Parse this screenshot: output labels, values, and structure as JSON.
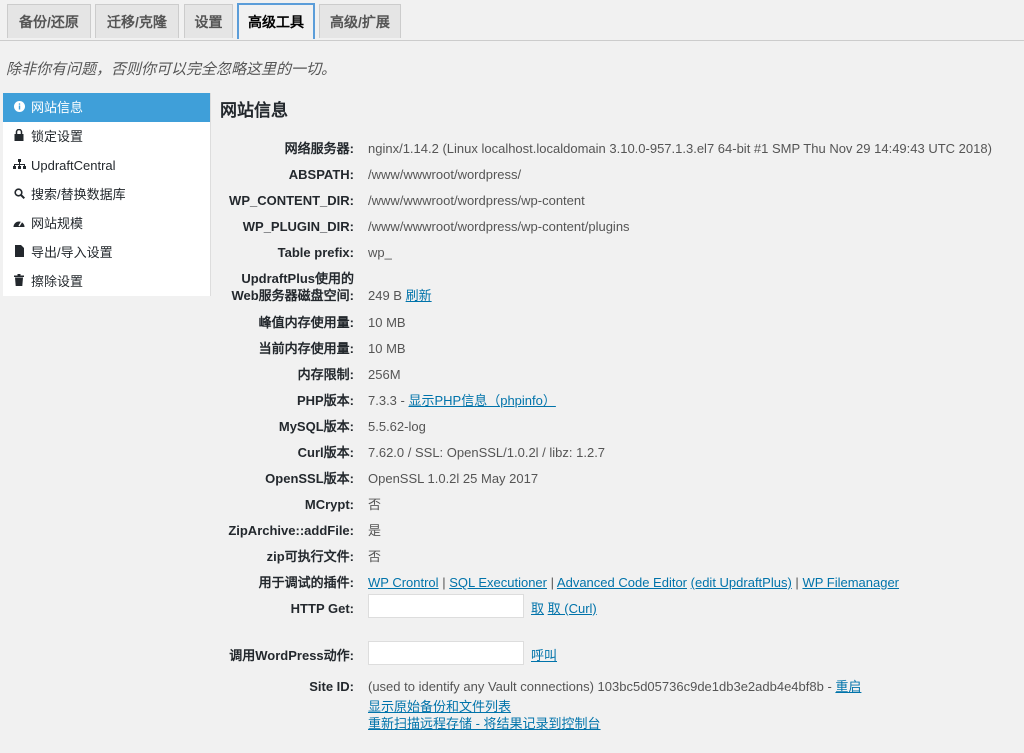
{
  "tabs": [
    {
      "label": "备份/还原"
    },
    {
      "label": "迁移/克隆"
    },
    {
      "label": "设置"
    },
    {
      "label": "高级工具"
    },
    {
      "label": "高级/扩展"
    }
  ],
  "notice": "除非你有问题，否则你可以完全忽略这里的一切。",
  "sidebar": {
    "items": [
      {
        "label": "网站信息",
        "icon": "info-icon"
      },
      {
        "label": "锁定设置",
        "icon": "lock-icon"
      },
      {
        "label": "UpdraftCentral",
        "icon": "sitemap-icon"
      },
      {
        "label": "搜索/替换数据库",
        "icon": "search-icon"
      },
      {
        "label": "网站规模",
        "icon": "dashboard-icon"
      },
      {
        "label": "导出/导入设置",
        "icon": "document-icon"
      },
      {
        "label": "擦除设置",
        "icon": "trash-icon"
      }
    ]
  },
  "main": {
    "title": "网站信息",
    "rows": {
      "web_server": {
        "label": "网络服务器:",
        "value": "nginx/1.14.2 (Linux localhost.localdomain 3.10.0-957.1.3.el7 64-bit #1 SMP Thu Nov 29 14:49:43 UTC 2018)"
      },
      "abspath": {
        "label": "ABSPATH:",
        "value": "/www/wwwroot/wordpress/"
      },
      "wp_content": {
        "label": "WP_CONTENT_DIR:",
        "value": "/www/wwwroot/wordpress/wp-content"
      },
      "wp_plugin": {
        "label": "WP_PLUGIN_DIR:",
        "value": "/www/wwwroot/wordpress/wp-content/plugins"
      },
      "table_prefix": {
        "label": "Table prefix:",
        "value": "wp_"
      },
      "disk": {
        "label_line1": "UpdraftPlus使用的",
        "label_line2": "Web服务器磁盘空间:",
        "value": "249 B",
        "link": "刷新"
      },
      "peak_mem": {
        "label": "峰值内存使用量:",
        "value": "10 MB"
      },
      "cur_mem": {
        "label": "当前内存使用量:",
        "value": "10 MB"
      },
      "mem_limit": {
        "label": "内存限制:",
        "value": "256M"
      },
      "php": {
        "label": "PHP版本:",
        "value": "7.3.3 -",
        "link": "显示PHP信息（phpinfo）"
      },
      "mysql": {
        "label": "MySQL版本:",
        "value": "5.5.62-log"
      },
      "curl": {
        "label": "Curl版本:",
        "value": "7.62.0 / SSL: OpenSSL/1.0.2l / libz: 1.2.7"
      },
      "openssl": {
        "label": "OpenSSL版本:",
        "value": "OpenSSL 1.0.2l 25 May 2017"
      },
      "mcrypt": {
        "label": "MCrypt:",
        "value": "否"
      },
      "ziparchive": {
        "label": "ZipArchive::addFile:",
        "value": "是"
      },
      "zip_exec": {
        "label": "zip可执行文件:",
        "value": "否"
      },
      "debug_plugins": {
        "label": "用于调试的插件:",
        "links": [
          "WP Crontrol",
          "SQL Executioner",
          "Advanced Code Editor",
          "(edit UpdraftPlus)",
          "WP Filemanager"
        ],
        "sep": "|"
      },
      "http_get": {
        "label": "HTTP Get:",
        "input_value": "",
        "btn1": "取",
        "btn2": "取 (Curl)"
      },
      "wp_action": {
        "label": "调用WordPress动作:",
        "input_value": "",
        "btn": "呼叫"
      },
      "site_id": {
        "label": "Site ID:",
        "value": "(used to identify any Vault connections) 103bc5d05736c9de1db3e2adb4e4bf8b -",
        "link": "重启"
      }
    },
    "links": {
      "raw_backup": "显示原始备份和文件列表",
      "rescan": "重新扫描远程存储 - 将结果记录到控制台"
    }
  },
  "colors": {
    "accent": "#3f9fd9",
    "link": "#0073aa",
    "background": "#f1f1f1"
  }
}
